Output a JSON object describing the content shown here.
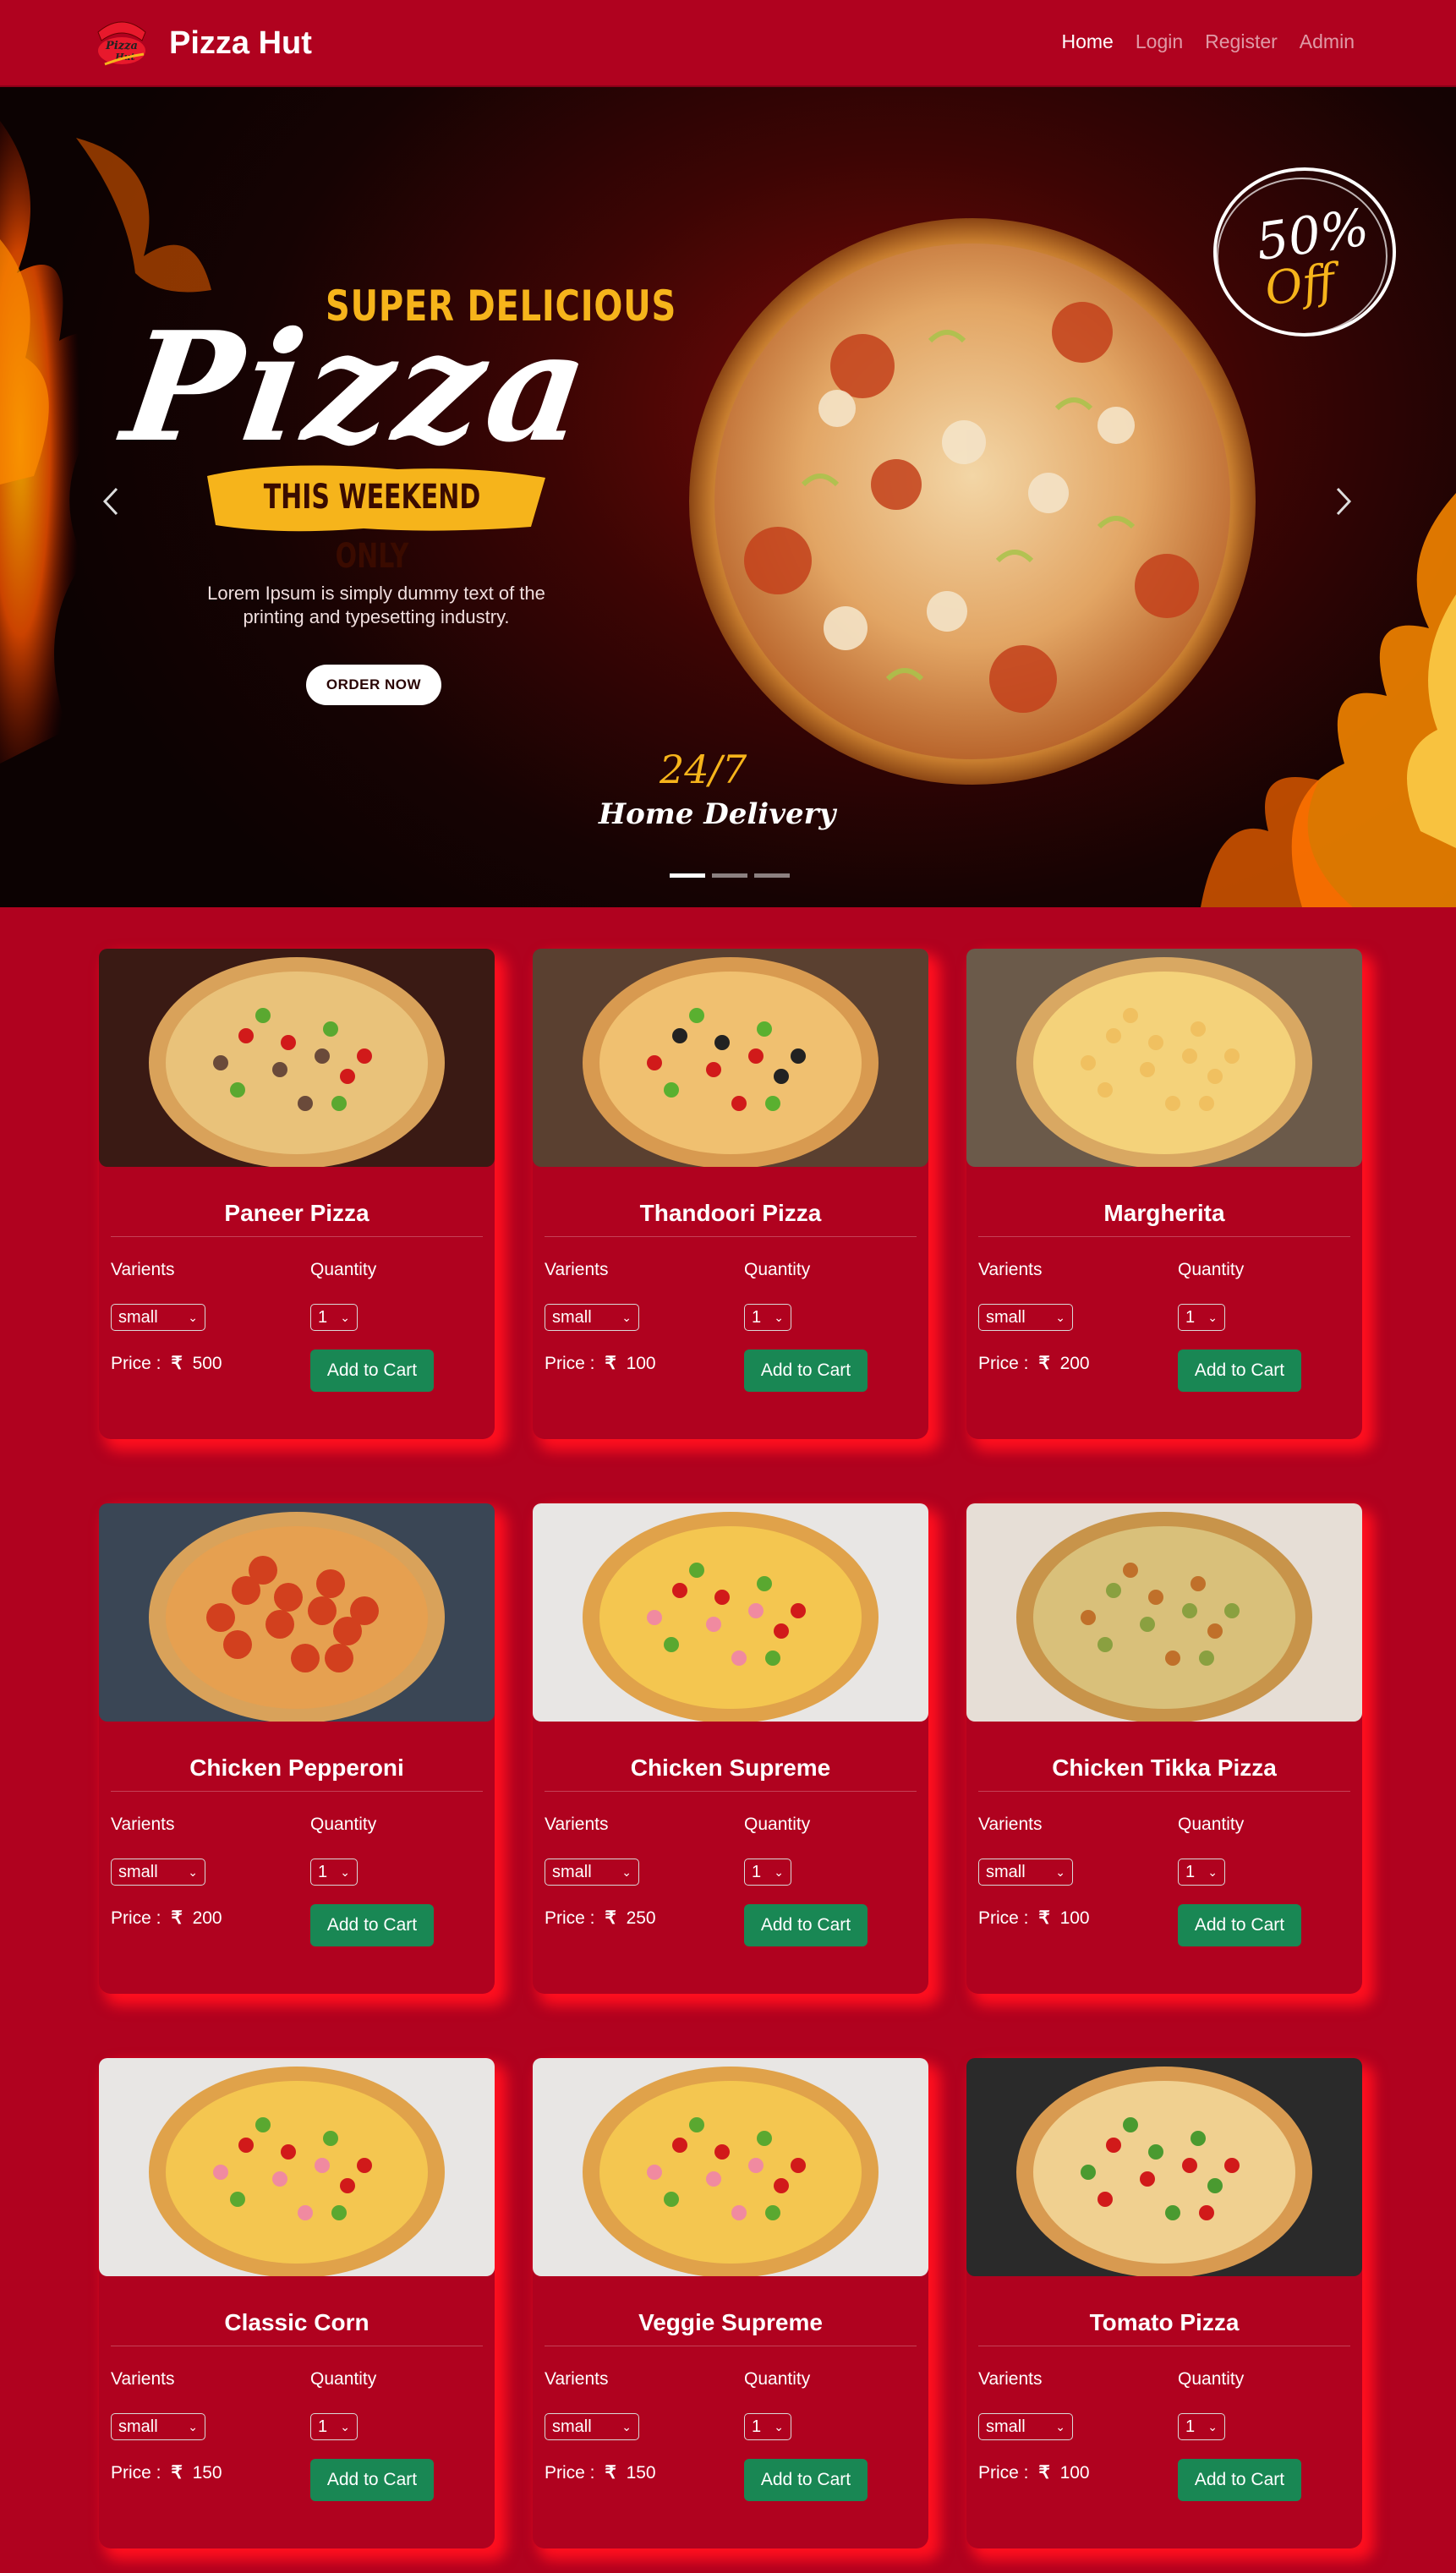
{
  "navbar": {
    "brand": "Pizza Hut",
    "logo_text": "Pizza Hut",
    "links": [
      {
        "label": "Home",
        "active": true
      },
      {
        "label": "Login",
        "active": false
      },
      {
        "label": "Register",
        "active": false
      },
      {
        "label": "Admin",
        "active": false
      }
    ]
  },
  "hero": {
    "super_text": "SUPER DELICIOUS",
    "pizza_word": "Pizza",
    "weekend_text": "THIS WEEKEND ONLY",
    "lorem": "Lorem Ipsum is simply dummy text of the printing and typesetting industry.",
    "order_button": "ORDER NOW",
    "offer_percent": "50%",
    "offer_off": "Off",
    "delivery_hours": "24/7",
    "delivery_text": "Home Delivery",
    "slide_count": 3,
    "active_slide": 0
  },
  "labels": {
    "varients": "Varients",
    "quantity": "Quantity",
    "price_prefix": "Price :",
    "currency": "₹",
    "add_to_cart": "Add to Cart"
  },
  "pizzas": [
    {
      "name": "Paneer Pizza",
      "variant": "small",
      "qty": "1",
      "price": "500"
    },
    {
      "name": "Thandoori Pizza",
      "variant": "small",
      "qty": "1",
      "price": "100"
    },
    {
      "name": "Margherita",
      "variant": "small",
      "qty": "1",
      "price": "200"
    },
    {
      "name": "Chicken Pepperoni",
      "variant": "small",
      "qty": "1",
      "price": "200"
    },
    {
      "name": "Chicken Supreme",
      "variant": "small",
      "qty": "1",
      "price": "250"
    },
    {
      "name": "Chicken Tikka Pizza",
      "variant": "small",
      "qty": "1",
      "price": "100"
    },
    {
      "name": "Classic Corn",
      "variant": "small",
      "qty": "1",
      "price": "150"
    },
    {
      "name": "Veggie Supreme",
      "variant": "small",
      "qty": "1",
      "price": "150"
    },
    {
      "name": "Tomato Pizza",
      "variant": "small",
      "qty": "1",
      "price": "100"
    }
  ],
  "colors": {
    "background": "#b0021f",
    "button_green": "#198754",
    "accent_gold": "#f6b41b"
  }
}
